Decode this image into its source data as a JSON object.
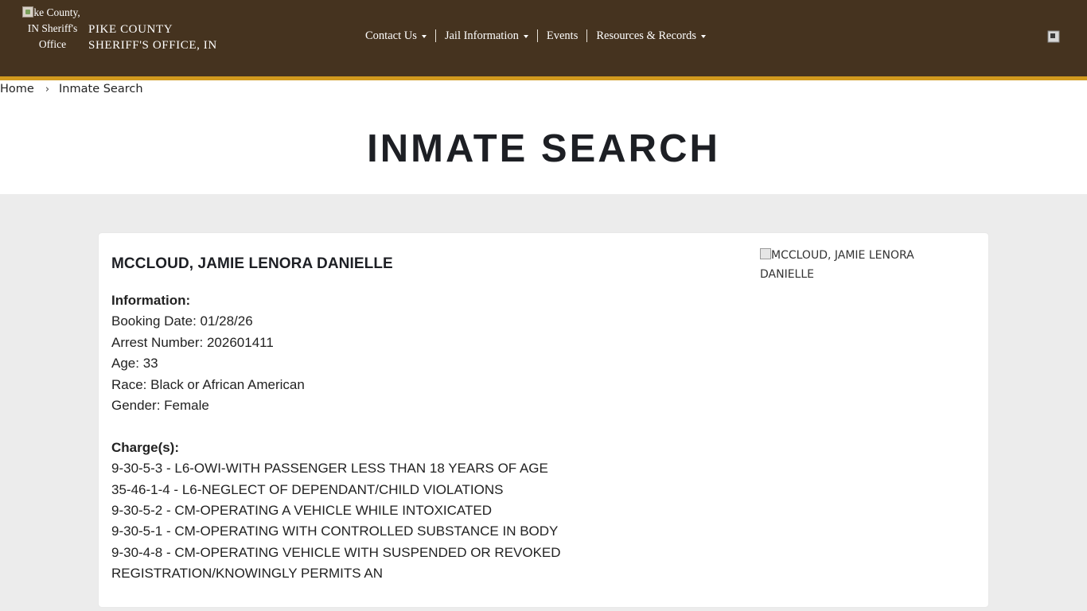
{
  "header": {
    "logo_alt": "Pike County, IN Sheriff's Office",
    "site_name_line1": "PIKE COUNTY",
    "site_name_line2": "SHERIFF'S OFFICE, IN",
    "nav": [
      {
        "label": "Contact Us",
        "dropdown": true
      },
      {
        "label": "Jail Information",
        "dropdown": true
      },
      {
        "label": "Events",
        "dropdown": false
      },
      {
        "label": "Resources & Records",
        "dropdown": true
      }
    ],
    "colors": {
      "bar": "#45331f",
      "accent": "#d19a1e"
    }
  },
  "breadcrumb": {
    "home": "Home",
    "separator": "›",
    "current": "Inmate Search"
  },
  "page_title": "INMATE SEARCH",
  "inmate": {
    "name": "MCCLOUD, JAMIE LENORA DANIELLE",
    "photo_alt": "MCCLOUD, JAMIE LENORA DANIELLE",
    "info_heading": "Information:",
    "booking_date": "Booking Date: 01/28/26",
    "arrest_number": "Arrest Number: 202601411",
    "age": "Age: 33",
    "race": "Race: Black or African American",
    "gender": "Gender: Female",
    "charges_heading": "Charge(s):",
    "charges": [
      "9-30-5-3 - L6-OWI-WITH PASSENGER LESS THAN 18 YEARS OF AGE",
      "35-46-1-4 - L6-NEGLECT OF DEPENDANT/CHILD VIOLATIONS",
      "9-30-5-2 - CM-OPERATING A VEHICLE WHILE INTOXICATED",
      "9-30-5-1 - CM-OPERATING WITH CONTROLLED SUBSTANCE IN BODY",
      "9-30-4-8 - CM-OPERATING VEHICLE WITH SUSPENDED OR REVOKED",
      "REGISTRATION/KNOWINGLY PERMITS AN"
    ]
  }
}
